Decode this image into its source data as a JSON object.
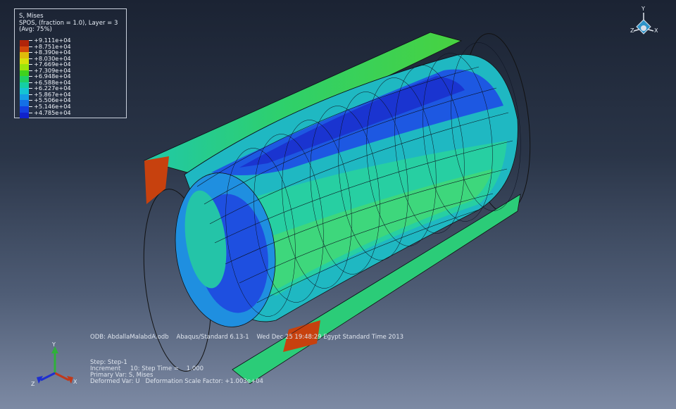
{
  "legend": {
    "title": "S, Mises",
    "subtitle": "SPOS, (fraction = 1.0), Layer = 3",
    "averaging": "(Avg: 75%)",
    "entries": [
      {
        "value": "+9.111e+04",
        "color": "#b0240a"
      },
      {
        "value": "+8.751e+04",
        "color": "#d2470a"
      },
      {
        "value": "+8.390e+04",
        "color": "#e0bb0a"
      },
      {
        "value": "+8.030e+04",
        "color": "#d7e10a"
      },
      {
        "value": "+7.669e+04",
        "color": "#9ce40c"
      },
      {
        "value": "+7.309e+04",
        "color": "#3fd21e"
      },
      {
        "value": "+6.948e+04",
        "color": "#1fd064"
      },
      {
        "value": "+6.588e+04",
        "color": "#15cfa4"
      },
      {
        "value": "+6.227e+04",
        "color": "#14c4d4"
      },
      {
        "value": "+5.867e+04",
        "color": "#149ee6"
      },
      {
        "value": "+5.506e+04",
        "color": "#1470e6"
      },
      {
        "value": "+5.146e+04",
        "color": "#1440e0"
      },
      {
        "value": "+4.785e+04",
        "color": "#1022cc"
      }
    ]
  },
  "odb_line": "ODB: AbdallaMalabdA.odb    Abaqus/Standard 6.13-1    Wed Dec 25 19:48:29 Egypt Standard Time 2013",
  "step_info": {
    "step": "Step: Step-1",
    "increment": "Increment     10: Step Time =    1.000",
    "primary_var": "Primary Var: S, Mises",
    "deformed_var": "Deformed Var: U   Deformation Scale Factor: +1.003e+04"
  },
  "triad": {
    "y": "Y",
    "x": "X",
    "z": "Z"
  },
  "view_cube_icon": "orientation-cube-icon"
}
